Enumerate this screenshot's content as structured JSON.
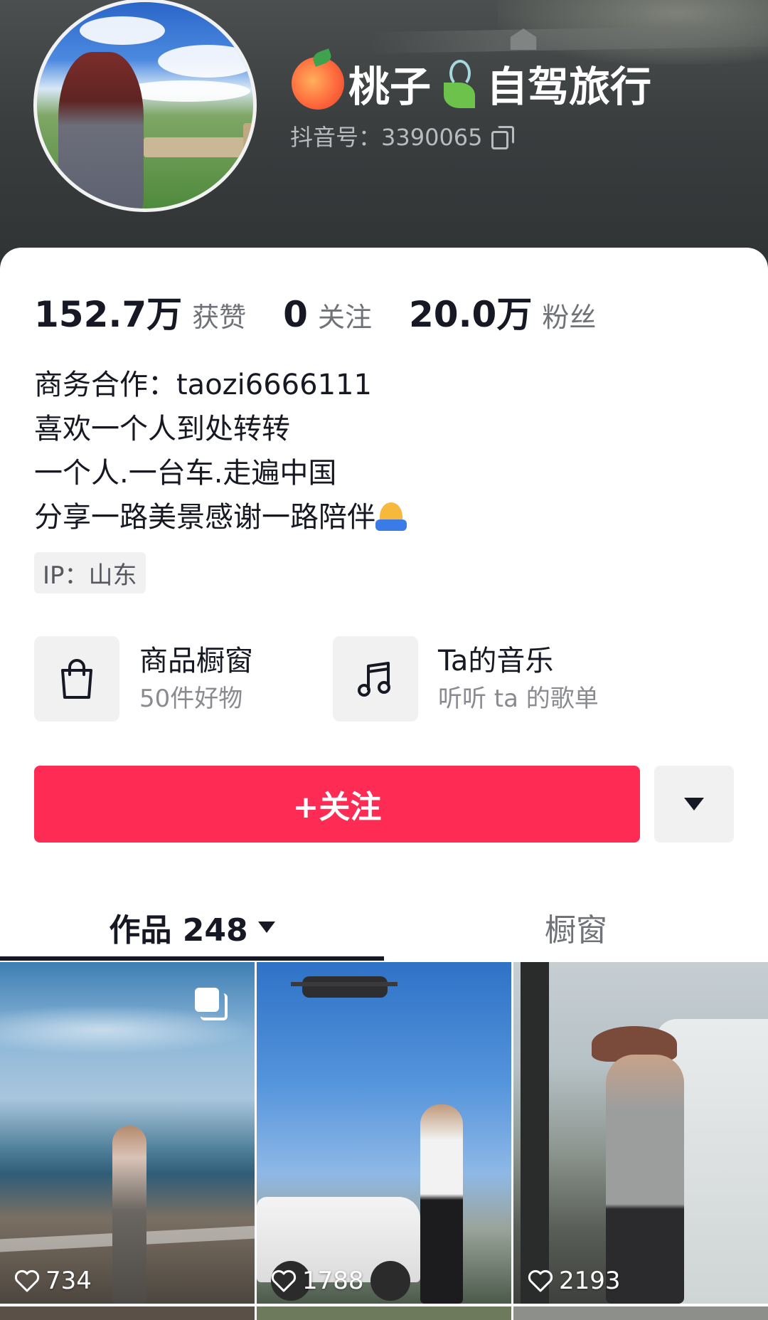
{
  "profile": {
    "name_part1": "桃子",
    "name_part2": "自驾旅行",
    "name_icons": [
      "peach-icon",
      "leaf-icon"
    ],
    "douyin_id": "抖音号：3390065",
    "copy_icon": "copy-icon"
  },
  "stats": {
    "likes_value": "152.7万",
    "likes_label": "获赞",
    "following_value": "0",
    "following_label": "关注",
    "followers_value": "20.0万",
    "followers_label": "粉丝"
  },
  "bio": {
    "line1": "商务合作：taozi6666111",
    "line2": "喜欢一个人到处转转",
    "line3": "一个人.一台车.走遍中国",
    "line4": "分享一路美景感谢一路陪伴",
    "line4_icon": "pray-icon"
  },
  "ip_tag": "IP：山东",
  "features": {
    "shop_title": "商品橱窗",
    "shop_sub": "50件好物",
    "shop_icon": "shopping-bag-icon",
    "music_title": "Ta的音乐",
    "music_sub": "听听 ta 的歌单",
    "music_icon": "music-note-icon"
  },
  "actions": {
    "follow_label": "+关注",
    "more_icon": "triangle-down-icon"
  },
  "tabs": {
    "works_label": "作品 248",
    "shop_label": "橱窗"
  },
  "videos": [
    {
      "likes": "734",
      "multi_image": true
    },
    {
      "likes": "1788",
      "multi_image": false
    },
    {
      "likes": "2193",
      "multi_image": false
    }
  ],
  "colors": {
    "accent": "#fe2c55",
    "header_bg": "#3a3e3f",
    "text_primary": "#161823",
    "text_secondary": "#6f7278"
  }
}
